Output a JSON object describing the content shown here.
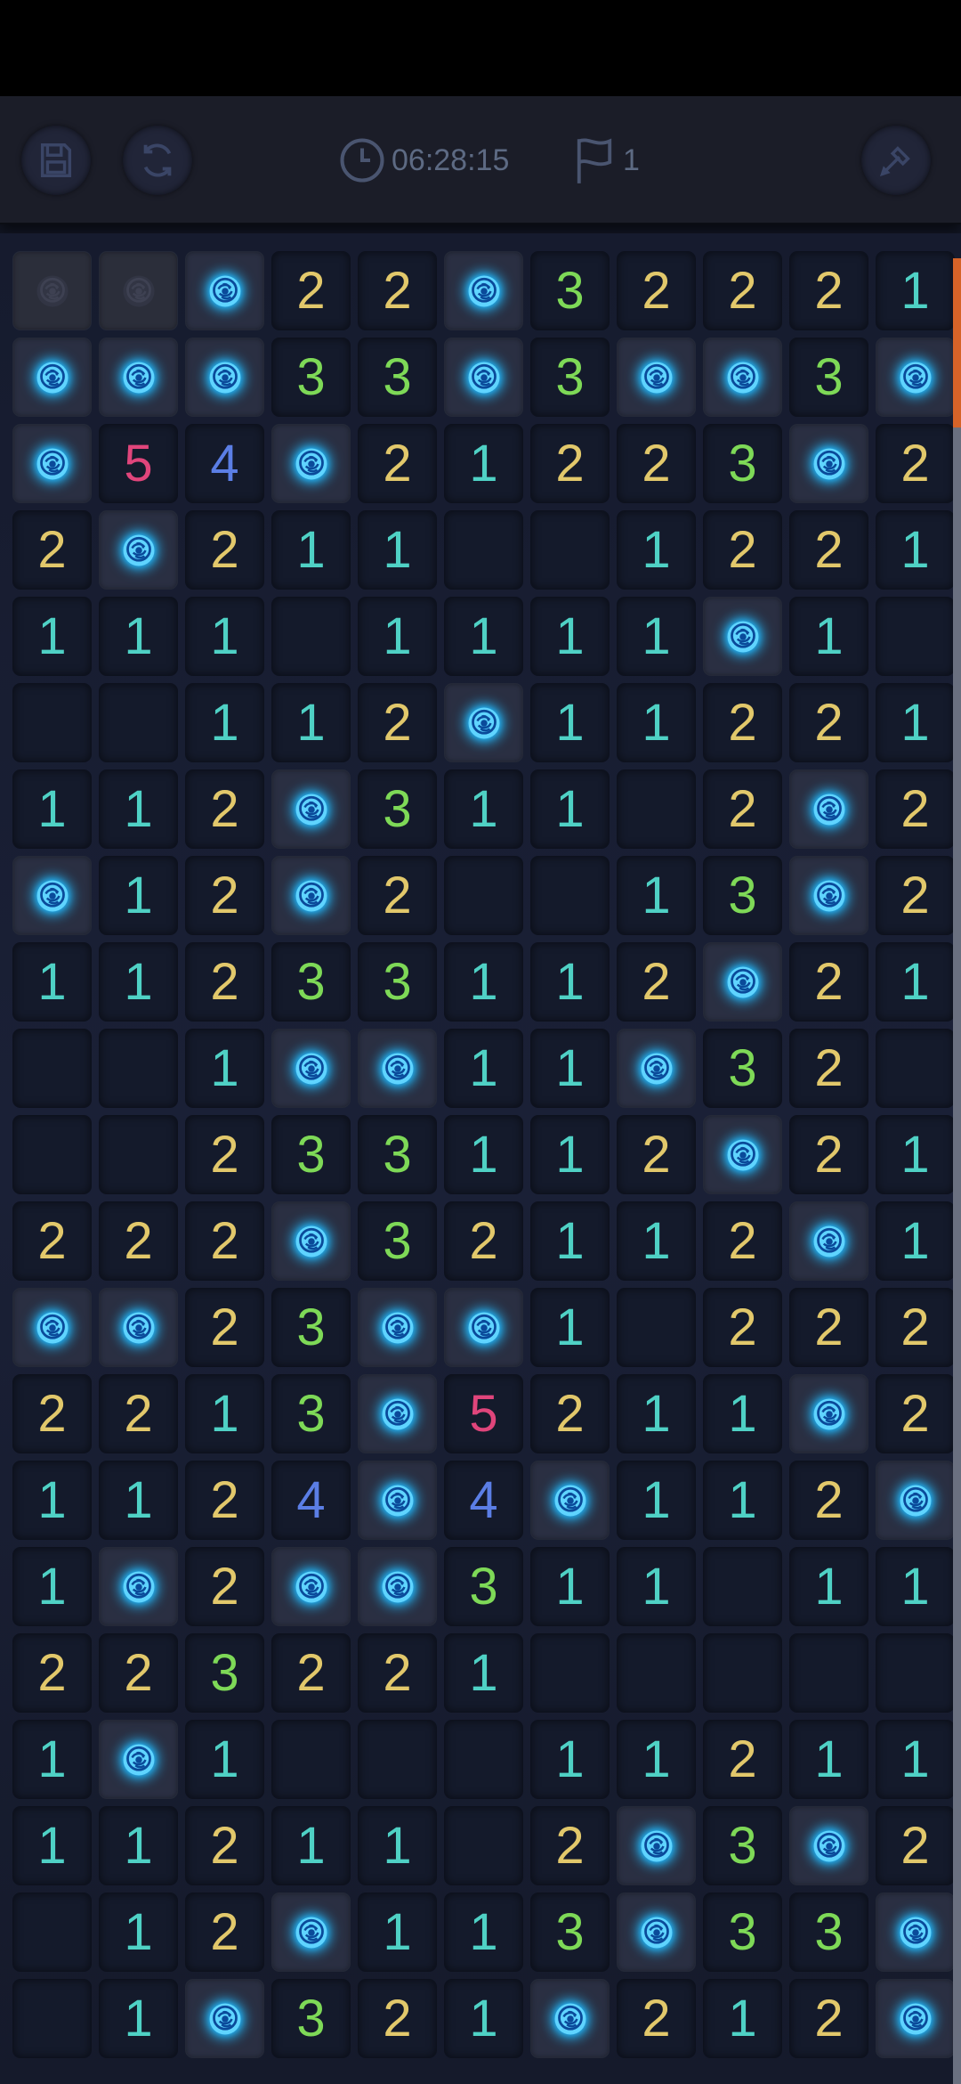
{
  "toolbar": {
    "timer": "06:28:15",
    "flag_count": "1",
    "icons": [
      "save-icon",
      "restart-icon",
      "clock-icon",
      "flag-icon",
      "dig-icon"
    ]
  },
  "colors": {
    "1": "#4fd1c5",
    "2": "#e2c86b",
    "3": "#7ed957",
    "4": "#5b7ee5",
    "5": "#e0457b",
    "mine_glow": "#1aa7ff",
    "scrollbar_thumb": "#d66328"
  },
  "board": {
    "columns": 11,
    "rows": [
      [
        "m-dim",
        "m-dim",
        "m",
        "2",
        "2",
        "m",
        "3",
        "2",
        "2",
        "2",
        "1"
      ],
      [
        "m",
        "m",
        "m",
        "3",
        "3",
        "m",
        "3",
        "m",
        "m",
        "3",
        "m"
      ],
      [
        "m",
        "5",
        "4",
        "m",
        "2",
        "1",
        "2",
        "2",
        "3",
        "m",
        "2"
      ],
      [
        "2",
        "m",
        "2",
        "1",
        "1",
        "",
        "",
        "1",
        "2",
        "2",
        "1"
      ],
      [
        "1",
        "1",
        "1",
        "",
        "1",
        "1",
        "1",
        "1",
        "m",
        "1",
        ""
      ],
      [
        "",
        "",
        "1",
        "1",
        "2",
        "m",
        "1",
        "1",
        "2",
        "2",
        "1"
      ],
      [
        "1",
        "1",
        "2",
        "m",
        "3",
        "1",
        "1",
        "",
        "2",
        "m",
        "2"
      ],
      [
        "m",
        "1",
        "2",
        "m",
        "2",
        "",
        "",
        "1",
        "3",
        "m",
        "2"
      ],
      [
        "1",
        "1",
        "2",
        "3",
        "3",
        "1",
        "1",
        "2",
        "m",
        "2",
        "1"
      ],
      [
        "",
        "",
        "1",
        "m",
        "m",
        "1",
        "1",
        "m",
        "3",
        "2",
        ""
      ],
      [
        "",
        "",
        "2",
        "3",
        "3",
        "1",
        "1",
        "2",
        "m",
        "2",
        "1"
      ],
      [
        "2",
        "2",
        "2",
        "m",
        "3",
        "2",
        "1",
        "1",
        "2",
        "m",
        "1"
      ],
      [
        "m",
        "m",
        "2",
        "3",
        "m",
        "m",
        "1",
        "",
        "2",
        "2",
        "2"
      ],
      [
        "2",
        "2",
        "1",
        "3",
        "m",
        "5",
        "2",
        "1",
        "1",
        "m",
        "2"
      ],
      [
        "1",
        "1",
        "2",
        "4",
        "m",
        "4",
        "m",
        "1",
        "1",
        "2",
        "m"
      ],
      [
        "1",
        "m",
        "2",
        "m",
        "m",
        "3",
        "1",
        "1",
        "",
        "1",
        "1"
      ],
      [
        "2",
        "2",
        "3",
        "2",
        "2",
        "1",
        "",
        "",
        "",
        "",
        ""
      ],
      [
        "1",
        "m",
        "1",
        "",
        "",
        "",
        "1",
        "1",
        "2",
        "1",
        "1"
      ],
      [
        "1",
        "1",
        "2",
        "1",
        "1",
        "",
        "2",
        "m",
        "3",
        "m",
        "2"
      ],
      [
        "",
        "1",
        "2",
        "m",
        "1",
        "1",
        "3",
        "m",
        "3",
        "3",
        "m"
      ],
      [
        "",
        "1",
        "m",
        "3",
        "2",
        "1",
        "m",
        "2",
        "1",
        "2",
        "m"
      ]
    ]
  }
}
